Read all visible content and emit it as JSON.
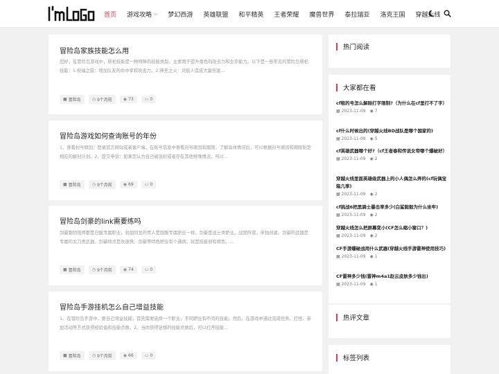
{
  "header": {
    "logo_text": "I'm LoGo",
    "nav": [
      {
        "label": "首页"
      },
      {
        "label": "游戏攻略"
      },
      {
        "label": "梦幻西游"
      },
      {
        "label": "英雄联盟"
      },
      {
        "label": "和平精英"
      },
      {
        "label": "王者荣耀"
      },
      {
        "label": "魔兽世界"
      },
      {
        "label": "泰拉瑞亚"
      },
      {
        "label": "洛克王国"
      },
      {
        "label": "穿越火线"
      }
    ],
    "icons": [
      "moon-icon",
      "search-icon"
    ]
  },
  "articles": [
    {
      "title": "冒险岛家族技能怎么用",
      "excerpt": "您好，在冒险岛游戏中，祭祀技能是一种特殊的技能类型，主要用于提升角色的攻击力和生存能力。以下是一些常见的冒险岛祭祀技能：1.祝福之唇：增加队友的命中率和攻击力。2.神圣之火：对敌人造成大量伤害...",
      "category": "冒险岛",
      "time": "9个月前",
      "views": "73",
      "comments": "0"
    },
    {
      "title": "冒险岛游戏如何查询账号的年份",
      "excerpt": "1、查看封号原因：登录官方网站或者客户端，在账号信息中查看封号原因和期限，了解具体情况后，可以根据封号原因和期限制定相应的解封计划。2、提交申诉：如果您认为自己被误封或者存在其他特殊情况，可以...",
      "category": "冒险岛",
      "time": "9个月前",
      "views": "69",
      "comments": "0"
    },
    {
      "title": "冒险岛剑豪的link需要练吗",
      "excerpt": "剑豪跟阴阳师都是日服专属职业，就如同龙的传人是国服专属职业一样。剑豪是战士类职业，战国阵营，单独创建。剑豪的武器是专属的太刀类武器，剑豪特点是攻速快、剑豪等特色职业有个通病，就是技能很有特色，...",
      "category": "冒险岛",
      "time": "9个月前",
      "views": "74",
      "comments": "0"
    },
    {
      "title": "冒险岛手游挂机怎么自己增益技能",
      "excerpt": "1、在冒险岛手游中，要自己增益技能，首先需要选择一个职业，不同职业有不同的技能。然后，在游戏中通过完成任务、打怪、参加活动等方式获得经验值和技能点数。2、当你获得足够的技能点数后，可以打开技能...",
      "category": "冒险岛",
      "time": "9个月前",
      "views": "66",
      "comments": "0"
    }
  ],
  "sidebar": {
    "hot_title": "热门阅读",
    "everyone_title": "大家都在看",
    "hot_comments_title": "热评文章",
    "tags_title": "标签列表",
    "everyone_items": [
      {
        "title": "cf租的号怎么解除打字限制?（为什么在cf里打不了字）",
        "date": "2023-11-09",
        "comments": "7"
      },
      {
        "title": "cf什么时候出的(穿越火线BD战队是哪个国家的)",
        "date": "2023-11-09",
        "comments": "5"
      },
      {
        "title": "cf英雄武器哪个好?（cf王者春和传说女帝哪个爆破好）",
        "date": "2023-11-09",
        "comments": "2"
      },
      {
        "title": "穿越火线里面英雄级武器上的小人偶怎么弄的(cf玩偶宝箱几率)",
        "date": "2023-11-09",
        "comments": "2"
      },
      {
        "title": "cf挑战6把黑骑士暴击率多少(白鲨毅毅为什么坐牢)",
        "date": "2023-11-09",
        "comments": "2"
      },
      {
        "title": "穿越火线怎么把屏幕变小(CF怎么缩小窗口？)",
        "date": "2023-11-09",
        "comments": "2"
      },
      {
        "title": "CF手游爆破战用什么武器(穿越火线手游雷神使用技巧)",
        "date": "2023-11-09",
        "comments": "1"
      },
      {
        "title": "CF雷神多少钱(雷神m4a1赵云皮肤多少钱出)",
        "date": "2023-11-09",
        "comments": "1"
      }
    ]
  },
  "colors": {
    "accent": "#e6394a",
    "background": "#f1f1f1",
    "card": "#ffffff"
  }
}
